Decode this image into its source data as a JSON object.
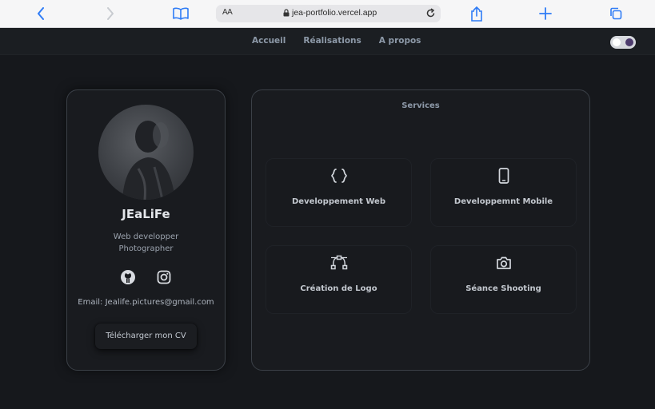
{
  "browser": {
    "text_size_label": "AA",
    "url": "jea-portfolio.vercel.app"
  },
  "nav": {
    "links": [
      "Accueil",
      "Réalisations",
      "A propos"
    ]
  },
  "profile": {
    "name": "JEaLiFe",
    "roles": [
      "Web developper",
      "Photographer"
    ],
    "email": "Email: Jealife.pictures@gmail.com",
    "cv_button": "Télécharger mon CV"
  },
  "services": {
    "title": "Services",
    "items": [
      {
        "label": "Developpement Web",
        "icon": "code-braces-icon"
      },
      {
        "label": "Developpemnt Mobile",
        "icon": "mobile-phone-icon"
      },
      {
        "label": "Création de Logo",
        "icon": "vector-pen-icon"
      },
      {
        "label": "Séance Shooting",
        "icon": "camera-icon"
      }
    ]
  },
  "colors": {
    "page_bg": "#16181c",
    "card_border": "#3b4047",
    "browser_accent": "#2f7cf6",
    "nav_text": "#8d99a8"
  }
}
